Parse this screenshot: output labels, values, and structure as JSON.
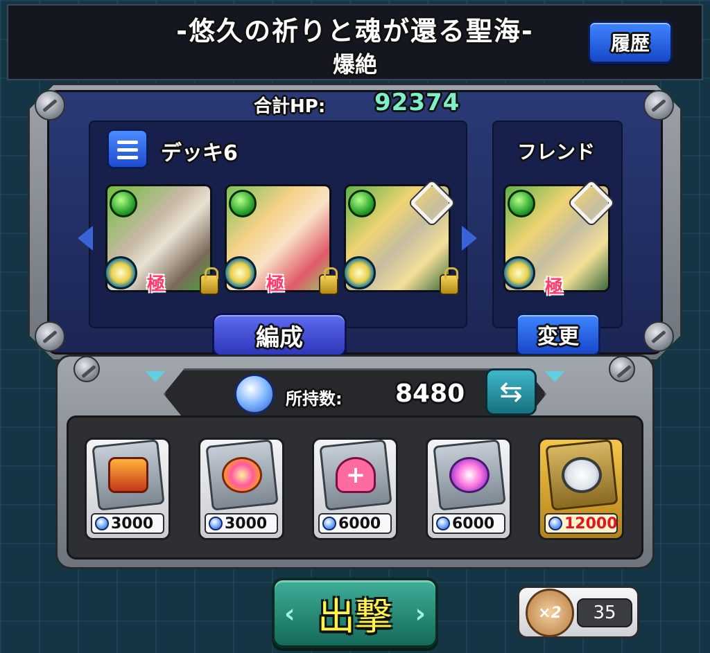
{
  "header": {
    "title": "-悠久の祈りと魂が還る聖海-",
    "subtitle": "爆絶",
    "history_label": "履歴"
  },
  "party": {
    "total_hp_label": "合計HP:",
    "total_hp_value": "92374",
    "deck_label": "デッキ6",
    "friend_label": "フレンド",
    "formation_label": "編成",
    "change_label": "変更",
    "deck_badges": [
      "極",
      "極"
    ],
    "friend_badge": "極"
  },
  "holdings": {
    "label": "所持数:",
    "value": "8480"
  },
  "items": [
    {
      "icon": "treasure-chest-icon",
      "price": "3000",
      "highlight": false
    },
    {
      "icon": "luck-orb-icon",
      "price": "3000",
      "highlight": false
    },
    {
      "icon": "heart-plus-icon",
      "price": "6000",
      "highlight": false
    },
    {
      "icon": "light-burst-icon",
      "price": "6000",
      "highlight": false
    },
    {
      "icon": "clock-speed-icon",
      "price": "12000",
      "highlight": true
    }
  ],
  "bottom": {
    "sortie_label": "出撃",
    "boost_multiplier": "×2",
    "boost_count": "35"
  },
  "colors": {
    "hp_value": "#7ef0c8",
    "price_highlight": "#e0161c",
    "sortie_text": "#fff34a"
  }
}
